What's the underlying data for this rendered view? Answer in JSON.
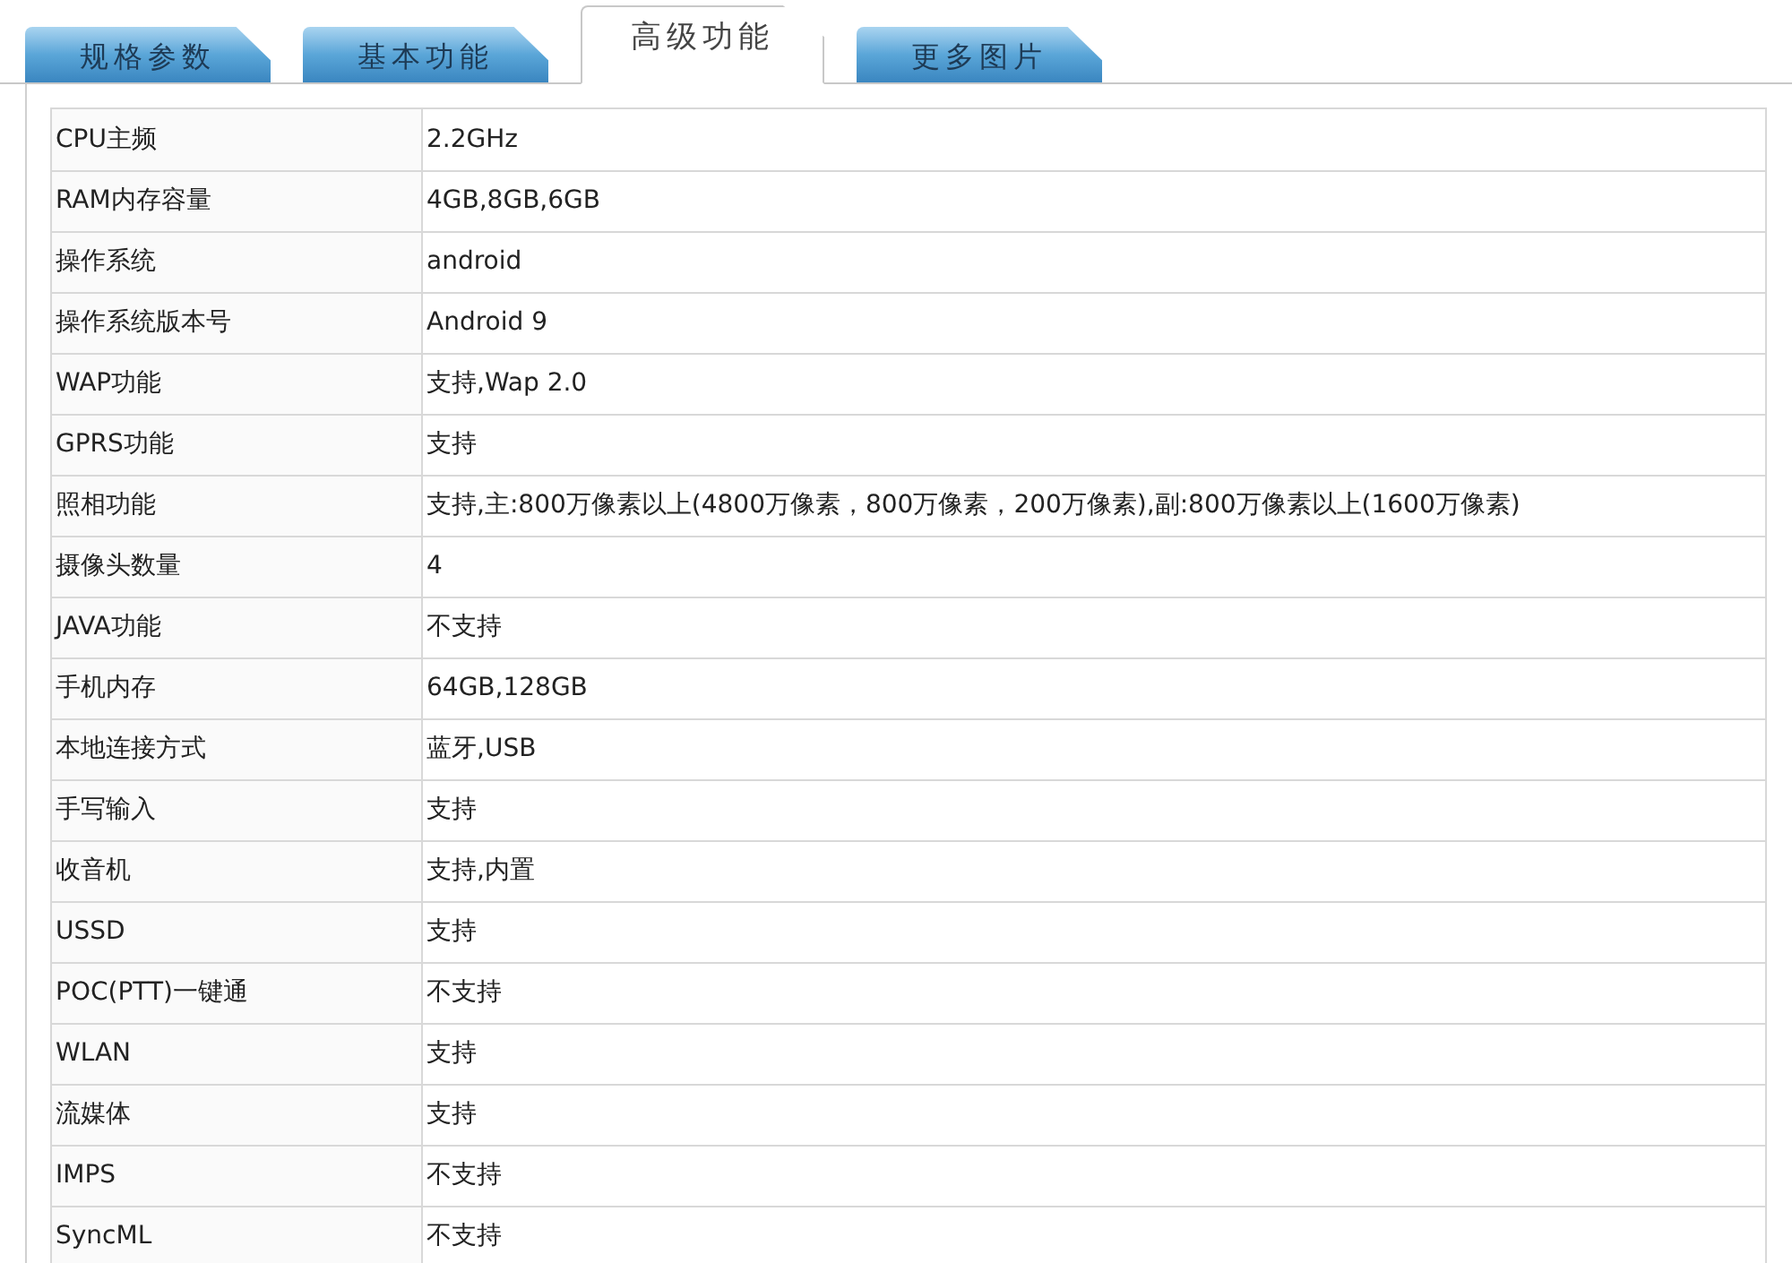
{
  "tabs": [
    {
      "label": "规格参数",
      "selected": false
    },
    {
      "label": "基本功能",
      "selected": false
    },
    {
      "label": "高级功能",
      "selected": true
    },
    {
      "label": "更多图片",
      "selected": false
    }
  ],
  "table": {
    "rows": [
      {
        "label": "CPU主频",
        "value": "2.2GHz"
      },
      {
        "label": "RAM内存容量",
        "value": "4GB,8GB,6GB"
      },
      {
        "label": "操作系统",
        "value": "android"
      },
      {
        "label": "操作系统版本号",
        "value": "Android 9"
      },
      {
        "label": "WAP功能",
        "value": "支持,Wap 2.0"
      },
      {
        "label": "GPRS功能",
        "value": "支持"
      },
      {
        "label": "照相功能",
        "value": "支持,主:800万像素以上(4800万像素，800万像素，200万像素),副:800万像素以上(1600万像素)"
      },
      {
        "label": "摄像头数量",
        "value": "4"
      },
      {
        "label": "JAVA功能",
        "value": "不支持"
      },
      {
        "label": "手机内存",
        "value": "64GB,128GB"
      },
      {
        "label": "本地连接方式",
        "value": "蓝牙,USB"
      },
      {
        "label": "手写输入",
        "value": "支持"
      },
      {
        "label": "收音机",
        "value": "支持,内置"
      },
      {
        "label": "USSD",
        "value": "支持"
      },
      {
        "label": "POC(PTT)一键通",
        "value": "不支持"
      },
      {
        "label": "WLAN",
        "value": "支持"
      },
      {
        "label": "流媒体",
        "value": "支持"
      },
      {
        "label": "IMPS",
        "value": "不支持"
      },
      {
        "label": "SyncML",
        "value": "不支持"
      }
    ]
  }
}
